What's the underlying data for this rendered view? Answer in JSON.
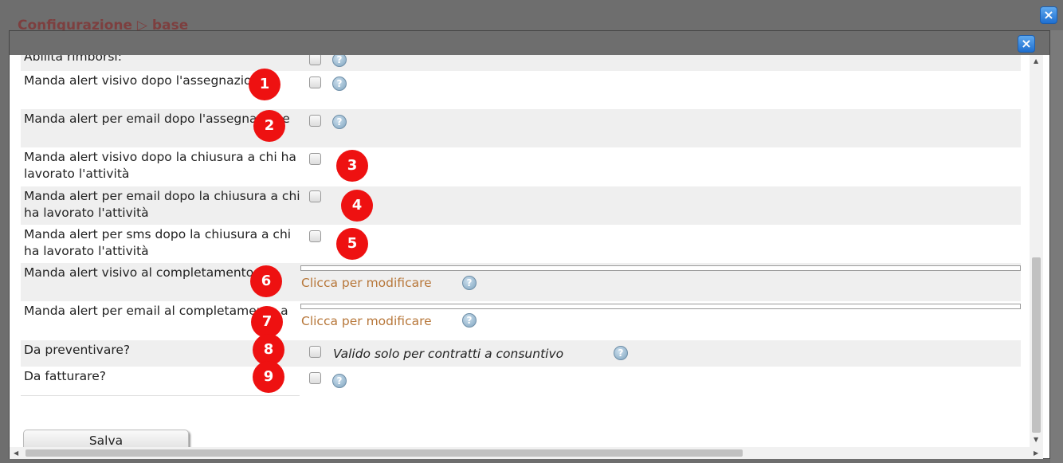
{
  "background": {
    "title": "Configurazione ▷ base",
    "close": "×"
  },
  "dialog": {
    "close": "×"
  },
  "rows": [
    {
      "label": "Abilita rimborsi:",
      "badge": ""
    },
    {
      "label": "Manda alert visivo dopo l'assegnazione",
      "badge": "1"
    },
    {
      "label": "Manda alert per email dopo l'assegnazione",
      "badge": "2"
    },
    {
      "label": "Manda alert visivo dopo la chiusura a chi ha lavorato l'attività",
      "badge": "3"
    },
    {
      "label": "Manda alert per email dopo la chiusura a chi ha lavorato l'attività",
      "badge": "4"
    },
    {
      "label": "Manda alert per sms dopo la chiusura a chi ha lavorato l'attività",
      "badge": "5"
    },
    {
      "label": "Manda alert visivo al completamento a",
      "badge": "6",
      "link": "Clicca per modificare"
    },
    {
      "label": "Manda alert per email al completamento a",
      "badge": "7",
      "link": "Clicca per modificare"
    },
    {
      "label": "Da preventivare?",
      "badge": "8",
      "note": "Valido solo per contratti a consuntivo"
    },
    {
      "label": "Da fatturare?",
      "badge": "9"
    }
  ],
  "help_glyph": "?",
  "save_label": "Salva"
}
